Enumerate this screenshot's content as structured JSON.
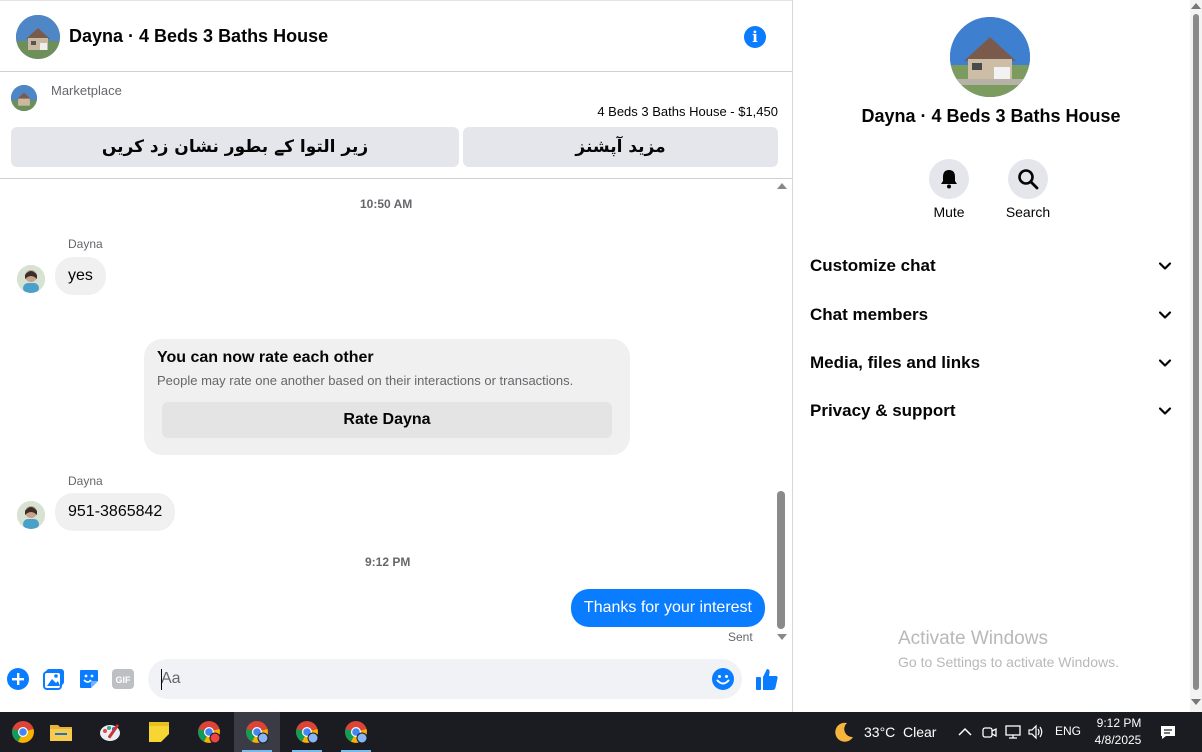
{
  "header": {
    "title": "Dayna · 4 Beds 3 Baths House",
    "info_icon": "info-icon"
  },
  "marketplace": {
    "label": "Marketplace",
    "listing": "4 Beds 3 Baths House - $1,450",
    "archive_button": "زیر التوا کے بطور نشان زد کریں",
    "more_options_button": "مزید آپشنز"
  },
  "messages": {
    "timestamp_1": "10:50 AM",
    "sender_1": "Dayna",
    "message_1": "yes",
    "rating_card": {
      "title": "You can now rate each other",
      "description": "People may rate one another based on their interactions or transactions.",
      "button": "Rate Dayna"
    },
    "sender_2": "Dayna",
    "message_2": "951-3865842",
    "timestamp_2": "9:12 PM",
    "outgoing_1": "Thanks for your interest",
    "status": "Sent"
  },
  "composer": {
    "placeholder": "Aa",
    "value": "",
    "icons": [
      "plus-icon",
      "photo-icon",
      "sticker-icon",
      "gif-icon",
      "emoji-icon",
      "thumbs-up-icon"
    ],
    "gif_label": "GIF"
  },
  "info_panel": {
    "title": "Dayna · 4 Beds 3 Baths House",
    "actions": [
      {
        "label": "Mute",
        "icon": "bell-icon"
      },
      {
        "label": "Search",
        "icon": "search-icon"
      }
    ],
    "sections": [
      {
        "label": "Customize chat"
      },
      {
        "label": "Chat members"
      },
      {
        "label": "Media, files and links"
      },
      {
        "label": "Privacy & support"
      }
    ]
  },
  "watermark": {
    "line1": "Activate Windows",
    "line2": "Go to Settings to activate Windows."
  },
  "taskbar": {
    "apps": [
      "chrome-icon",
      "file-explorer-icon",
      "paint-icon",
      "sticky-notes-icon",
      "chrome-profile-icon",
      "chrome-profile-icon",
      "chrome-profile-icon",
      "chrome-profile-icon"
    ],
    "weather_temp": "33°C",
    "weather_condition": "Clear",
    "language": "ENG",
    "time": "9:12 PM",
    "date": "4/8/2025"
  },
  "colors": {
    "accent": "#0a7cff",
    "bubble_incoming": "#f0f0f0",
    "taskbar": "#1b1b22"
  }
}
